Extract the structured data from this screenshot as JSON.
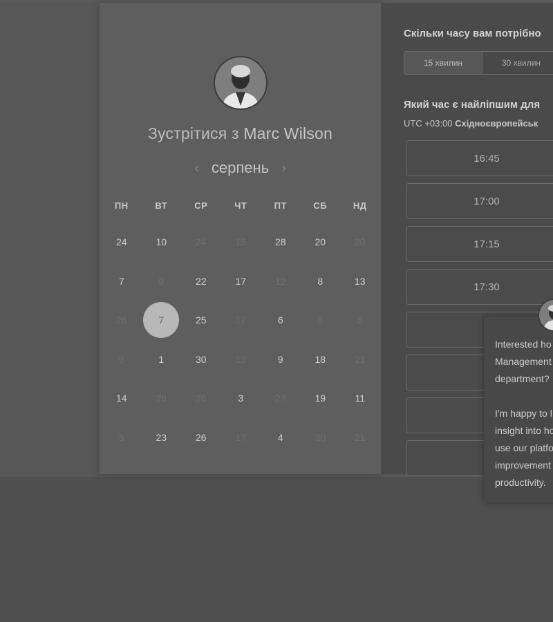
{
  "scheduler": {
    "title_prefix": "Зустрітися з",
    "host_name": "Marc Wilson",
    "month": "серпень",
    "prev_arrow": "‹",
    "next_arrow": "›",
    "weekdays": [
      "ПН",
      "ВТ",
      "СР",
      "ЧТ",
      "ПТ",
      "СБ",
      "НД"
    ],
    "weeks": [
      [
        "24",
        "10",
        "24",
        "15",
        "28",
        "20",
        "20"
      ],
      [
        "7",
        "9",
        "22",
        "17",
        "12",
        "8",
        "13"
      ],
      [
        "26",
        "7",
        "25",
        "17",
        "6",
        "5",
        "5"
      ],
      [
        "9",
        "1",
        "30",
        "13",
        "9",
        "18",
        "21"
      ],
      [
        "14",
        "28",
        "26",
        "3",
        "27",
        "19",
        "11"
      ],
      [
        "5",
        "23",
        "26",
        "17",
        "4",
        "30",
        "21"
      ]
    ],
    "selected_day": "7"
  },
  "booking": {
    "duration_question": "Скільки часу вам потрібно",
    "durations": [
      "15 хвилин",
      "30 хвилин"
    ],
    "time_question": "Який час є найліпшим для",
    "timezone_offset": "UTC +03:00",
    "timezone_name": "Східноєвропейськ",
    "slots": [
      "16:45",
      "17:00",
      "17:15",
      "17:30",
      "",
      "",
      "",
      ""
    ]
  },
  "chat_popup": {
    "lines": [
      "Interested ho",
      "Management",
      "department?",
      "",
      "I'm happy to l",
      "insight into ho",
      "use our platfo",
      "improvement",
      "productivity."
    ]
  },
  "icons": {
    "avatar": "person-photo",
    "prev": "chevron-left-icon",
    "next": "chevron-right-icon"
  }
}
